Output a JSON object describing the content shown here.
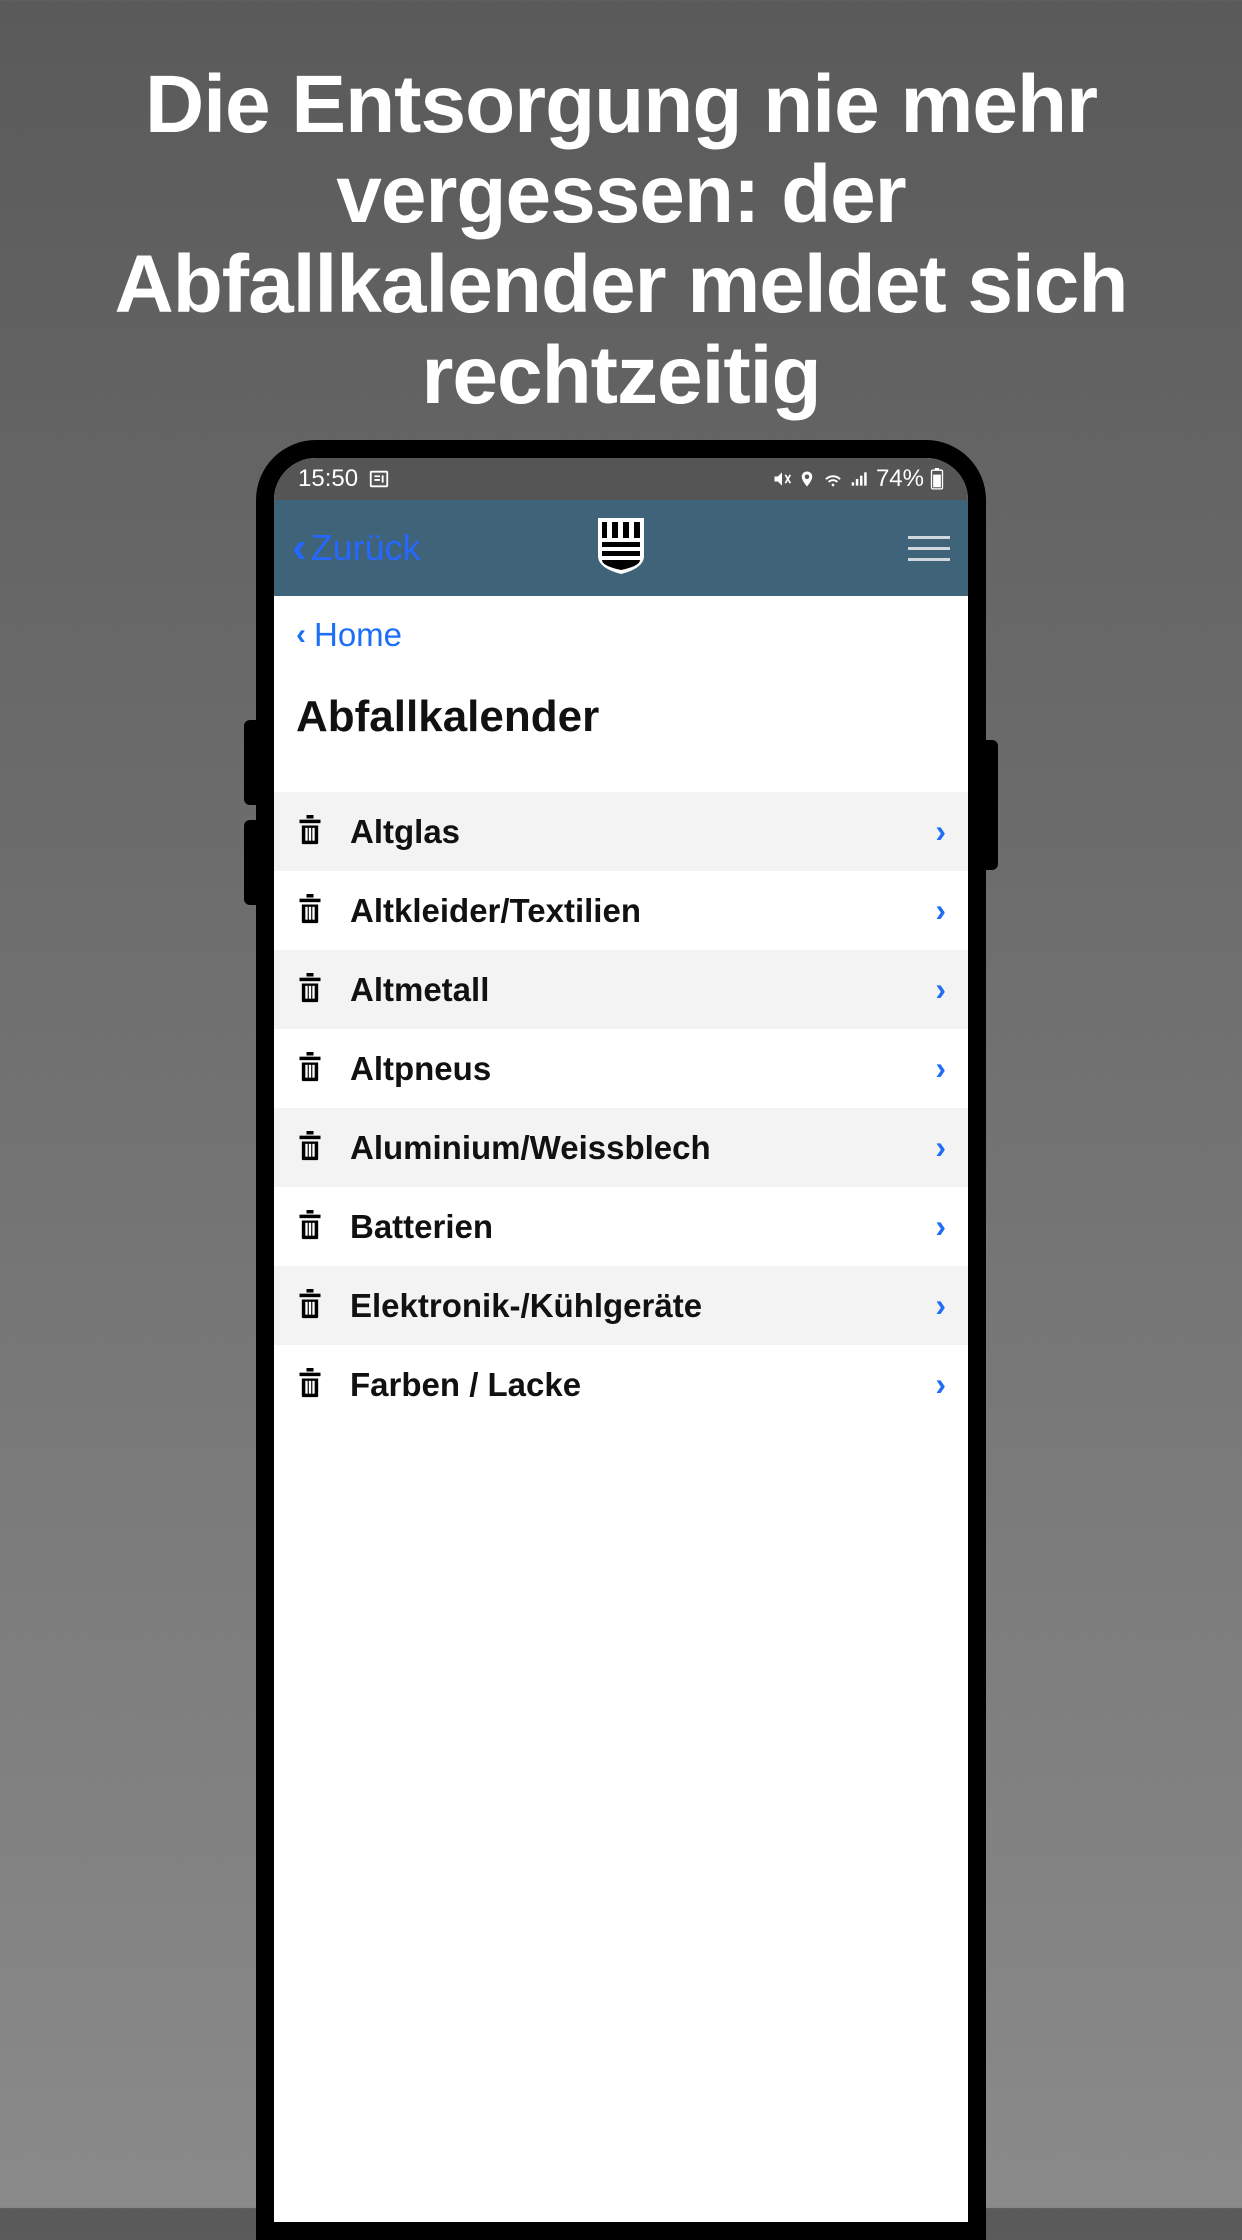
{
  "promo": {
    "text": "Die Entsorgung nie mehr vergessen: der Abfallkalender meldet sich rechtzeitig"
  },
  "status_bar": {
    "time": "15:50",
    "battery": "74%"
  },
  "nav": {
    "back_label": "Zurück"
  },
  "sub_nav": {
    "home_label": "Home"
  },
  "page": {
    "title": "Abfallkalender"
  },
  "list": {
    "items": [
      {
        "label": "Altglas"
      },
      {
        "label": "Altkleider/Textilien"
      },
      {
        "label": "Altmetall"
      },
      {
        "label": "Altpneus"
      },
      {
        "label": "Aluminium/Weissblech"
      },
      {
        "label": "Batterien"
      },
      {
        "label": "Elektronik-/Kühlgeräte"
      },
      {
        "label": "Farben / Lacke"
      }
    ]
  }
}
